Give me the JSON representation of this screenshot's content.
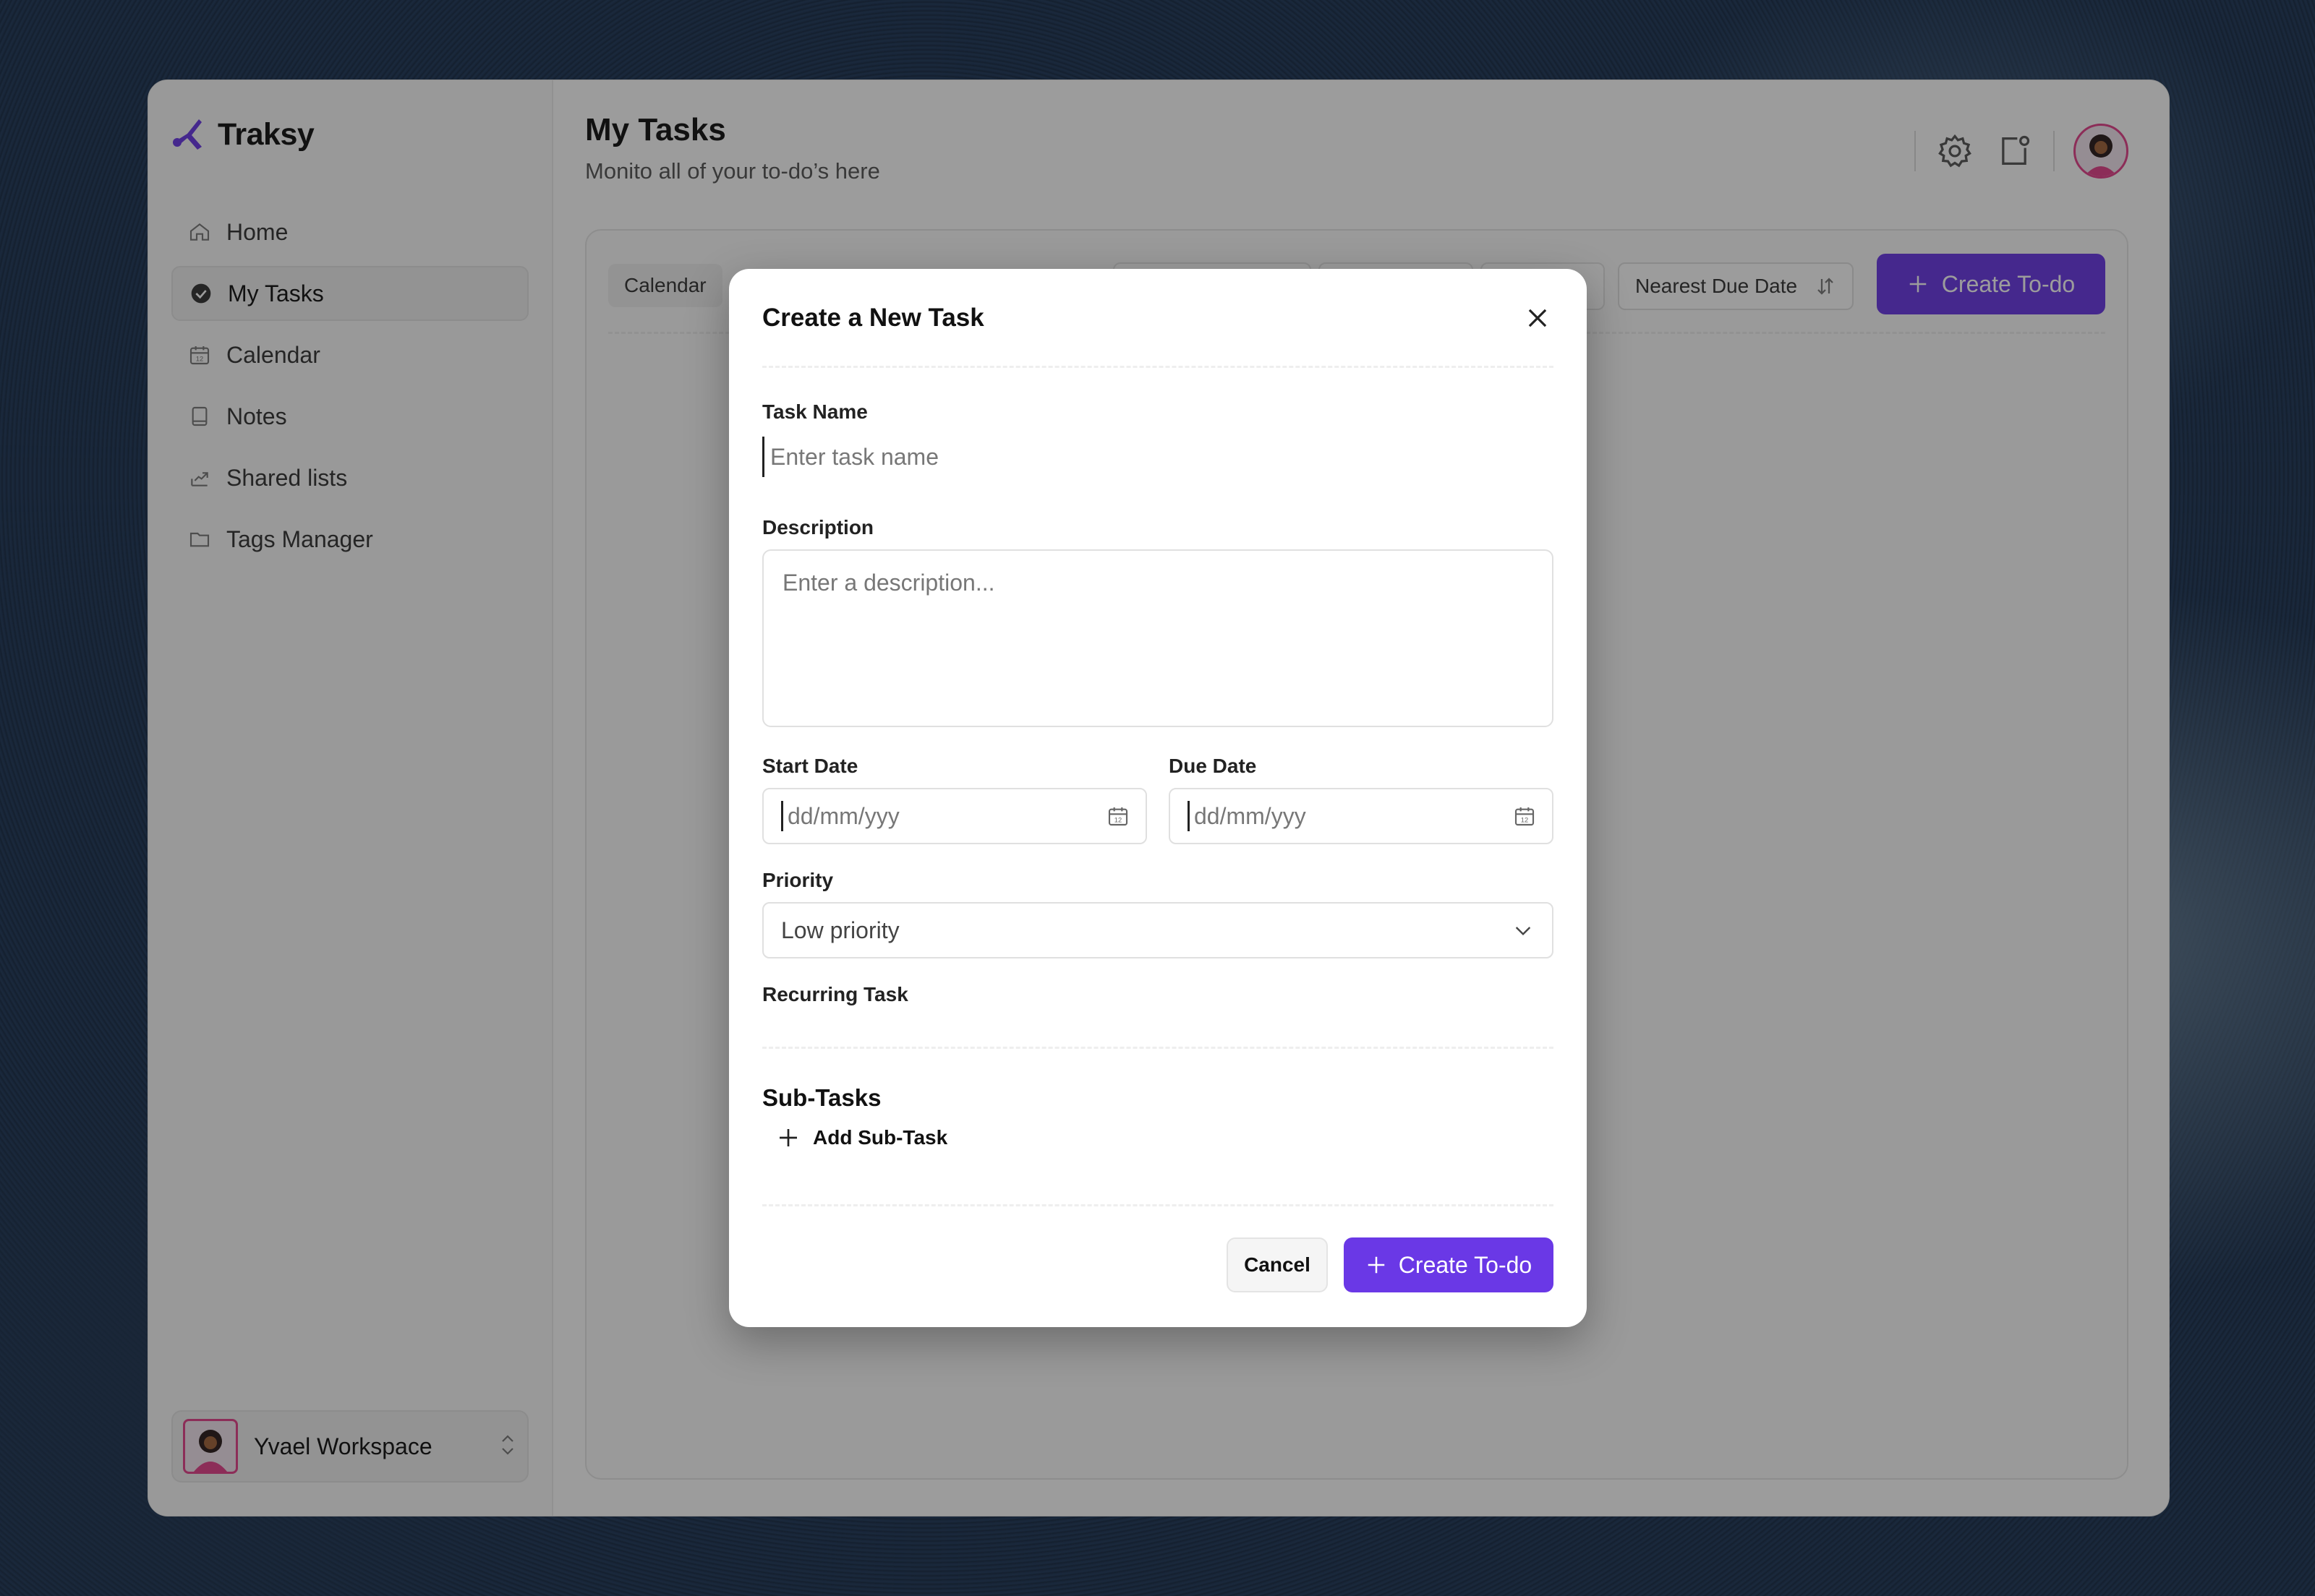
{
  "app": {
    "name": "Traksy",
    "brand_color": "#6a38e6"
  },
  "sidebar": {
    "items": [
      {
        "label": "Home",
        "icon": "home-icon"
      },
      {
        "label": "My Tasks",
        "icon": "check-circle-icon",
        "active": true
      },
      {
        "label": "Calendar",
        "icon": "calendar-icon"
      },
      {
        "label": "Notes",
        "icon": "notebook-icon"
      },
      {
        "label": "Shared lists",
        "icon": "share-icon"
      },
      {
        "label": "Tags Manager",
        "icon": "folder-icon"
      }
    ],
    "workspace": {
      "name": "Yvael Workspace"
    }
  },
  "header": {
    "title": "My Tasks",
    "subtitle": "Monito all of your to-do’s here"
  },
  "board": {
    "tab_calendar": "Calendar",
    "sort_label": "Nearest Due Date",
    "create_label": "Create To-do"
  },
  "modal": {
    "title": "Create a New Task",
    "task_name": {
      "label": "Task Name",
      "placeholder": "Enter task name",
      "value": ""
    },
    "description": {
      "label": "Description",
      "placeholder": "Enter a description...",
      "value": ""
    },
    "start_date": {
      "label": "Start Date",
      "placeholder": "dd/mm/yyy"
    },
    "due_date": {
      "label": "Due Date",
      "placeholder": "dd/mm/yyy"
    },
    "priority": {
      "label": "Priority",
      "selected": "Low priority"
    },
    "recurring": {
      "label": "Recurring Task"
    },
    "subtasks": {
      "title": "Sub-Tasks",
      "add_label": "Add Sub-Task"
    },
    "cancel_label": "Cancel",
    "create_label": "Create To-do"
  }
}
